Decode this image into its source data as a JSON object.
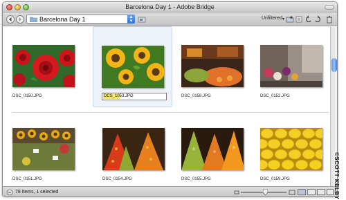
{
  "window": {
    "title": "Barcelona Day 1 - Adobe Bridge"
  },
  "toolbar": {
    "path": "Barcelona Day 1",
    "filter_label": "Unfiltered",
    "icons": [
      "back-arrow-icon",
      "forward-arrow-icon",
      "folder-icon",
      "reveal-icon",
      "new-folder-icon",
      "rotate-left-icon",
      "rotate-right-icon",
      "trash-icon",
      "open-recent-icon"
    ]
  },
  "thumbnails": [
    {
      "filename": "DSC_0150.JPG",
      "subject": "red roses",
      "selected": false
    },
    {
      "filename_highlight": "DCS_1053",
      "filename_ext": ".JPG",
      "subject": "sunflowers",
      "selected": true
    },
    {
      "filename": "DSC_0158.JPG",
      "subject": "market stall produce",
      "selected": false
    },
    {
      "filename": "DSC_0152.JPG",
      "subject": "flower stall street",
      "selected": false
    },
    {
      "filename": "DSC_0151.JPG",
      "subject": "sunflower stall",
      "selected": false
    },
    {
      "filename": "DSC_0154.JPG",
      "subject": "fruit pyramids",
      "selected": false
    },
    {
      "filename": "DSC_0155.JPG",
      "subject": "fruit pyramids",
      "selected": false
    },
    {
      "filename": "DSC_0159.JPG",
      "subject": "lemons",
      "selected": false
    }
  ],
  "statusbar": {
    "text": "78 items, 1 selected"
  },
  "watermark": "©SCOTT KELBY",
  "colors": {
    "selection_bg": "#eef3fa",
    "scroll_thumb": "#4c8fe6",
    "rename_highlight": "#f5e86c"
  }
}
